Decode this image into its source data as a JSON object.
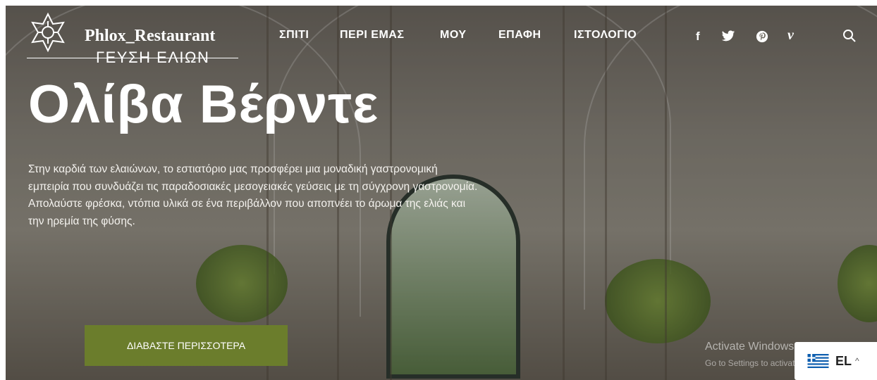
{
  "brand": {
    "name": "Phlox_Restaurant",
    "tagline": "ΓΕΥΣΗ ΕΛΙΩΝ"
  },
  "nav": {
    "items": [
      "ΣΠΙΤΙ",
      "ΠΕΡΙ ΕΜΑΣ",
      "ΜΟΥ",
      "ΕΠΑΦΗ",
      "ΙΣΤΟΛΟΓΙΟ"
    ]
  },
  "social": {
    "facebook": "f",
    "twitter_icon": "twitter-icon",
    "pinterest": "℗",
    "vimeo": "v",
    "search_icon": "search-icon"
  },
  "hero": {
    "title": "Ολίβα Βέρντε",
    "description": "Στην καρδιά των ελαιώνων, το εστιατόριο μας προσφέρει μια μοναδική γαστρονομική εμπειρία που συνδυάζει τις παραδοσιακές μεσογειακές γεύσεις με τη σύγχρονη γαστρονομία. Απολαύστε φρέσκα, ντόπια υλικά σε ένα περιβάλλον που αποπνέει το άρωμα της ελιάς και την ηρεμία της φύσης.",
    "cta": "ΔΙΑΒΑΣΤΕ ΠΕΡΙΣΣΟΤΕΡΑ"
  },
  "system": {
    "activate_title": "Activate Windows",
    "activate_sub": "Go to Settings to activate Windows."
  },
  "language": {
    "code": "EL",
    "chevron": "^"
  },
  "colors": {
    "accent": "#6b7d2c",
    "text": "#ffffff"
  }
}
